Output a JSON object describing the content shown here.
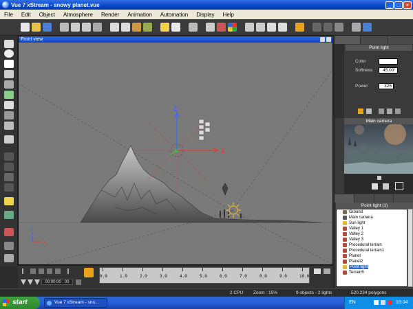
{
  "window": {
    "title": "Vue 7 xStream - snowy planet.vue"
  },
  "menu": [
    "File",
    "Edit",
    "Object",
    "Atmosphere",
    "Render",
    "Animation",
    "Automation",
    "Display",
    "Help"
  ],
  "viewport": {
    "title": "Front view"
  },
  "properties": {
    "header": "Point light",
    "color_label": "Color",
    "softness_label": "Softness",
    "softness_value": "45.00°",
    "power_label": "Power",
    "power_value": "325"
  },
  "camera": {
    "header": "Main camera"
  },
  "world_browser": {
    "header": "Point light (1)",
    "items": [
      {
        "label": "Ground",
        "color": "#7a6b55"
      },
      {
        "label": "Main camera",
        "color": "#555555"
      },
      {
        "label": "Sun light",
        "color": "#e6b53a"
      },
      {
        "label": "Valley 1",
        "color": "#b64a3a"
      },
      {
        "label": "Valley 2",
        "color": "#b64a3a"
      },
      {
        "label": "Valley 3",
        "color": "#b64a3a"
      },
      {
        "label": "Procedural terrain",
        "color": "#b64a3a"
      },
      {
        "label": "Procedural terrain1",
        "color": "#b64a3a"
      },
      {
        "label": "Planet",
        "color": "#b64a3a"
      },
      {
        "label": "Planet2",
        "color": "#b64a3a"
      },
      {
        "label": "Point light",
        "color": "#e6b53a",
        "selected": true
      },
      {
        "label": "Terrain5",
        "color": "#b64a3a"
      }
    ]
  },
  "timeline": {
    "time": "00:00:00 : 00",
    "ticks": [
      "0.0",
      "1.0",
      "2.0",
      "3.0",
      "4.0",
      "5.0",
      "6.0",
      "7.0",
      "8.0",
      "9.0",
      "10.0"
    ]
  },
  "status": {
    "cpu": "2 CPU",
    "zoom": "Zoom : 15%",
    "objects": "9 objects - 2 lights",
    "polygons": "520,234 polygons"
  },
  "taskbar": {
    "start": "start",
    "task": "Vue 7 xStream - sno...",
    "lang": "EN",
    "clock": "16:04"
  },
  "colors": {
    "accent": "#0a46c8",
    "selection": "#316ac5",
    "timeline_key": "#e8a21c"
  }
}
